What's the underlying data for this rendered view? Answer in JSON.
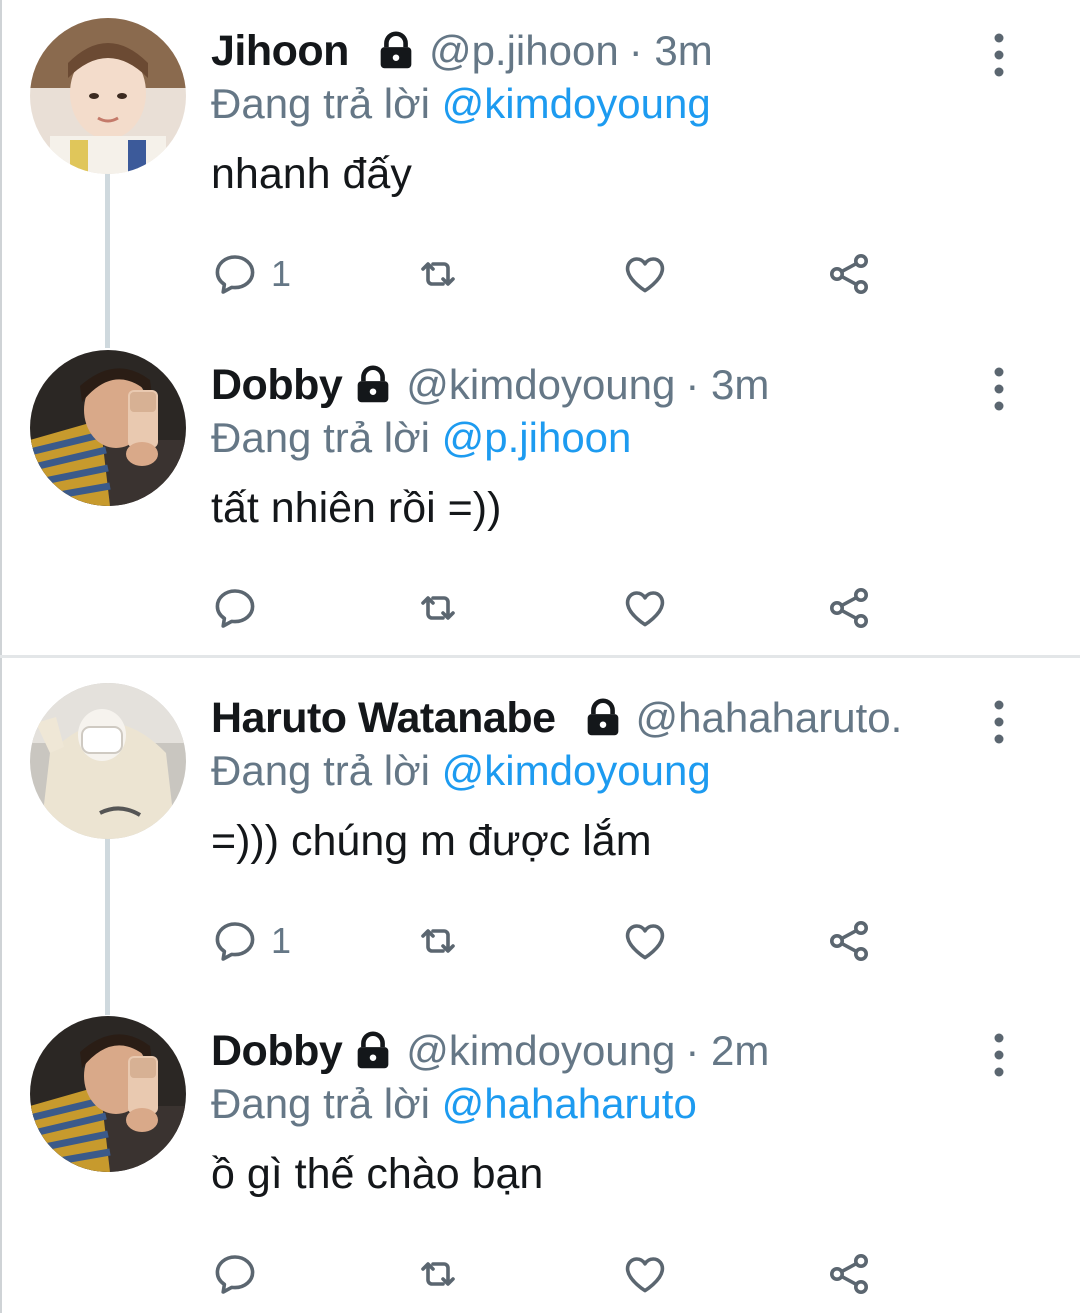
{
  "reply_prefix": "Đang trả lời",
  "colors": {
    "accent": "#1d9bf0",
    "secondary_text": "#657786",
    "thread_line": "#cfd9de"
  },
  "icons": {
    "lock": "lock-icon",
    "more": "more-vertical-icon",
    "reply": "reply-icon",
    "retweet": "retweet-icon",
    "like": "like-icon",
    "share": "share-icon"
  },
  "tweets": [
    {
      "name": "Jihoon",
      "handle": "@p.jihoon",
      "time": "· 3m",
      "reply_to": "@kimdoyoung",
      "text": "nhanh đấy",
      "reply_count": "1"
    },
    {
      "name": "Dobby",
      "handle": "@kimdoyoung",
      "time": "· 3m",
      "reply_to": "@p.jihoon",
      "text": "tất nhiên rồi =))",
      "reply_count": ""
    },
    {
      "name": "Haruto Watanabe",
      "handle": "@hahaharuto.",
      "time": "",
      "reply_to": "@kimdoyoung",
      "text": "=))) chúng m được lắm",
      "reply_count": "1"
    },
    {
      "name": "Dobby",
      "handle": "@kimdoyoung",
      "time": "· 2m",
      "reply_to": "@hahaharuto",
      "text": "ồ gì thế chào bạn",
      "reply_count": ""
    }
  ]
}
